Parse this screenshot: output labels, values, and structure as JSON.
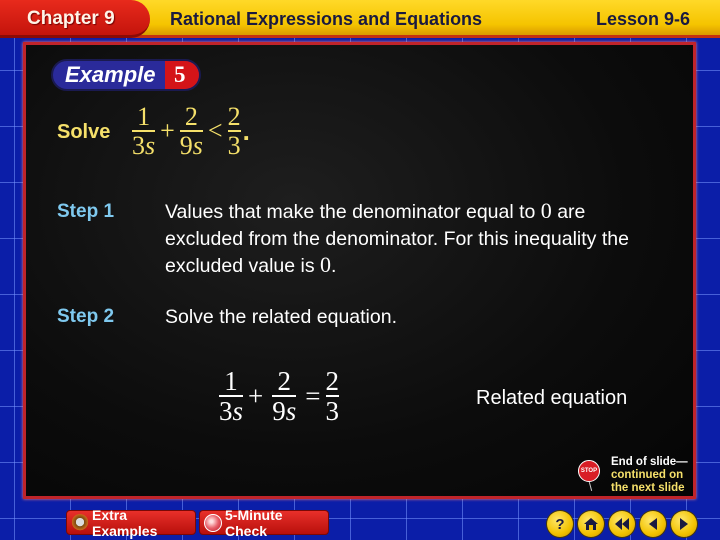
{
  "header": {
    "chapter": "Chapter 9",
    "title": "Rational Expressions and Equations",
    "lesson": "Lesson 9-6"
  },
  "example": {
    "label": "Example",
    "number": "5"
  },
  "problem": {
    "solve_label": "Solve",
    "inequality": {
      "term1": {
        "num": "1",
        "den_coef": "3",
        "den_var": "s"
      },
      "op1": "+",
      "term2": {
        "num": "2",
        "den_coef": "9",
        "den_var": "s"
      },
      "relation": "<",
      "rhs": {
        "num": "2",
        "den": "3"
      },
      "end": "."
    }
  },
  "steps": [
    {
      "label": "Step 1",
      "text_parts": [
        "Values that make the denominator equal to ",
        "0",
        " are excluded from the denominator. For this inequality the excluded value is ",
        "0",
        "."
      ]
    },
    {
      "label": "Step 2",
      "text": "Solve the related equation."
    }
  ],
  "related_equation": {
    "term1": {
      "num": "1",
      "den_coef": "3",
      "den_var": "s"
    },
    "op1": "+",
    "term2": {
      "num": "2",
      "den_coef": "9",
      "den_var": "s"
    },
    "relation": "=",
    "rhs": {
      "num": "2",
      "den": "3"
    },
    "caption": "Related equation"
  },
  "end_note": {
    "stop_icon_text": "STOP",
    "line1": "End of slide—",
    "line2": "continued on",
    "line3": "the next slide"
  },
  "bottom_buttons": {
    "extra_examples": "Extra Examples",
    "five_minute_check": "5-Minute Check"
  },
  "nav": {
    "help": "?",
    "home_icon": "home-icon",
    "first_icon": "rewind-icon",
    "prev_icon": "previous-icon",
    "next_icon": "next-icon"
  },
  "colors": {
    "header_yellow": "#f5c400",
    "chapter_red": "#d41418",
    "step_blue": "#7fc9ef",
    "solve_yellow": "#f5e06a",
    "background_blue": "#0b1ea8"
  }
}
